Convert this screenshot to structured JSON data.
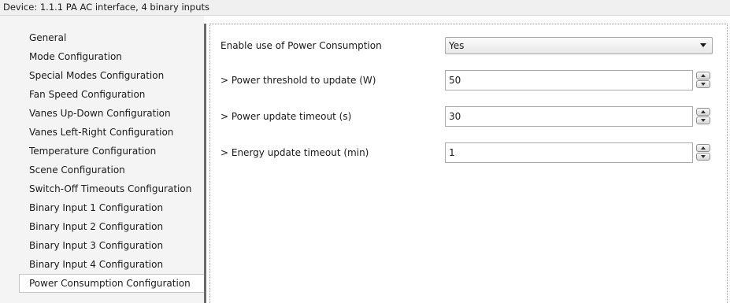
{
  "header": {
    "title": "Device: 1.1.1  PA AC interface, 4 binary inputs"
  },
  "sidebar": {
    "items": [
      {
        "label": "General",
        "active": false
      },
      {
        "label": "Mode Configuration",
        "active": false
      },
      {
        "label": "Special Modes Configuration",
        "active": false
      },
      {
        "label": "Fan Speed Configuration",
        "active": false
      },
      {
        "label": "Vanes Up-Down Configuration",
        "active": false
      },
      {
        "label": "Vanes Left-Right Configuration",
        "active": false
      },
      {
        "label": "Temperature Configuration",
        "active": false
      },
      {
        "label": "Scene Configuration",
        "active": false
      },
      {
        "label": "Switch-Off Timeouts Configuration",
        "active": false
      },
      {
        "label": "Binary Input 1 Configuration",
        "active": false
      },
      {
        "label": "Binary Input 2 Configuration",
        "active": false
      },
      {
        "label": "Binary Input 3 Configuration",
        "active": false
      },
      {
        "label": "Binary Input 4 Configuration",
        "active": false
      },
      {
        "label": "Power Consumption Configuration",
        "active": true
      }
    ]
  },
  "settings": {
    "enable_power": {
      "label": "Enable use of Power Consumption",
      "value": "Yes",
      "control": "dropdown"
    },
    "power_threshold": {
      "label": "> Power threshold to update (W)",
      "value": "50",
      "control": "spinner"
    },
    "power_timeout": {
      "label": "> Power update timeout (s)",
      "value": "30",
      "control": "spinner"
    },
    "energy_timeout": {
      "label": "> Energy update timeout (min)",
      "value": "1",
      "control": "spinner"
    }
  },
  "icons": {
    "dropdown": "chevron-down-icon",
    "spin_up": "arrow-up-icon",
    "spin_down": "arrow-down-icon"
  },
  "colors": {
    "sidebar_bg": "#f4f4f4",
    "title_bar_bg": "#f0f0f0",
    "splitter": "#6a6a6a",
    "content_bg": "#ffffff"
  }
}
